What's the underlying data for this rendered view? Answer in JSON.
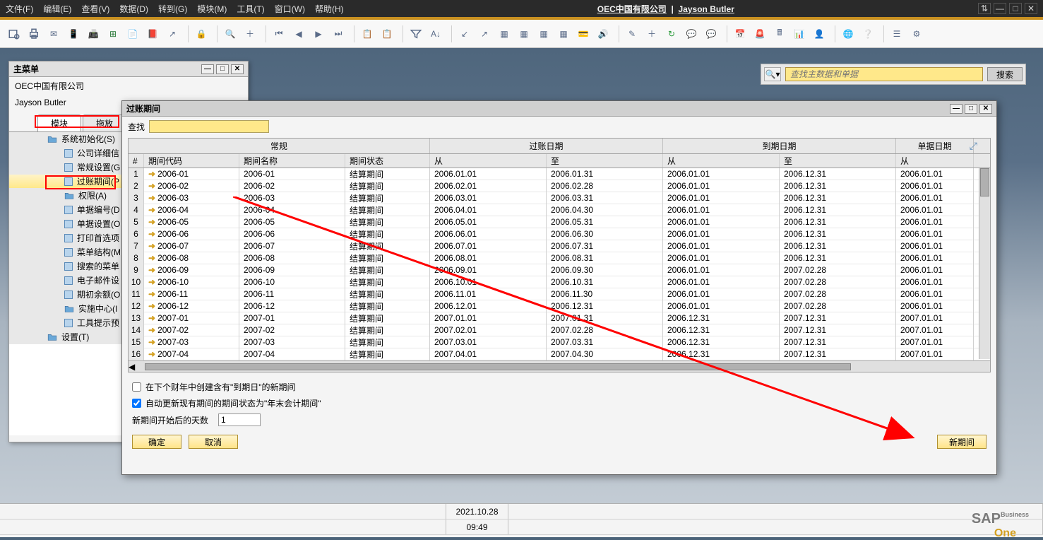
{
  "menubar": {
    "items": [
      "文件(F)",
      "编辑(E)",
      "查看(V)",
      "数据(D)",
      "转到(G)",
      "模块(M)",
      "工具(T)",
      "窗口(W)",
      "帮助(H)"
    ],
    "title_company": "OEC中国有限公司",
    "title_user": "Jayson Butler"
  },
  "topsearch": {
    "placeholder": "查找主数据和单据",
    "button": "搜索"
  },
  "mainmenu": {
    "title": "主菜单",
    "company": "OEC中国有限公司",
    "user": "Jayson Butler",
    "tabs": [
      "模块",
      "拖放"
    ],
    "tree": [
      {
        "lvl": 1,
        "type": "folder",
        "label": "系统初始化(S)"
      },
      {
        "lvl": 2,
        "type": "doc",
        "label": "公司详细信"
      },
      {
        "lvl": 2,
        "type": "doc",
        "label": "常规设置(G"
      },
      {
        "lvl": 2,
        "type": "doc",
        "label": "过账期间(P",
        "selected": true
      },
      {
        "lvl": 2,
        "type": "folder",
        "label": "权限(A)"
      },
      {
        "lvl": 2,
        "type": "doc",
        "label": "单据编号(D"
      },
      {
        "lvl": 2,
        "type": "doc",
        "label": "单据设置(O"
      },
      {
        "lvl": 2,
        "type": "doc",
        "label": "打印首选项"
      },
      {
        "lvl": 2,
        "type": "doc",
        "label": "菜单结构(M"
      },
      {
        "lvl": 2,
        "type": "doc",
        "label": "搜索的菜单"
      },
      {
        "lvl": 2,
        "type": "doc",
        "label": "电子邮件设"
      },
      {
        "lvl": 2,
        "type": "doc",
        "label": "期初余额(O"
      },
      {
        "lvl": 2,
        "type": "folder",
        "label": "实施中心(I"
      },
      {
        "lvl": 2,
        "type": "doc",
        "label": "工具提示预"
      },
      {
        "lvl": 1,
        "type": "folder",
        "label": "设置(T)"
      }
    ]
  },
  "dialog": {
    "title": "过账期间",
    "search_label": "查找",
    "groups": [
      "常规",
      "过账日期",
      "到期日期",
      "单据日期"
    ],
    "columns": {
      "num": "#",
      "code": "期间代码",
      "name": "期间名称",
      "status": "期间状态",
      "pfrom": "从",
      "pto": "至",
      "dfrom": "从",
      "dto": "至",
      "docfrom": "从"
    },
    "rows": [
      {
        "n": 1,
        "code": "2006-01",
        "name": "2006-01",
        "status": "结算期间",
        "pf": "2006.01.01",
        "pt": "2006.01.31",
        "df": "2006.01.01",
        "dt": "2006.12.31",
        "doc": "2006.01.01"
      },
      {
        "n": 2,
        "code": "2006-02",
        "name": "2006-02",
        "status": "结算期间",
        "pf": "2006.02.01",
        "pt": "2006.02.28",
        "df": "2006.01.01",
        "dt": "2006.12.31",
        "doc": "2006.01.01"
      },
      {
        "n": 3,
        "code": "2006-03",
        "name": "2006-03",
        "status": "结算期间",
        "pf": "2006.03.01",
        "pt": "2006.03.31",
        "df": "2006.01.01",
        "dt": "2006.12.31",
        "doc": "2006.01.01"
      },
      {
        "n": 4,
        "code": "2006-04",
        "name": "2006-04",
        "status": "结算期间",
        "pf": "2006.04.01",
        "pt": "2006.04.30",
        "df": "2006.01.01",
        "dt": "2006.12.31",
        "doc": "2006.01.01"
      },
      {
        "n": 5,
        "code": "2006-05",
        "name": "2006-05",
        "status": "结算期间",
        "pf": "2006.05.01",
        "pt": "2006.05.31",
        "df": "2006.01.01",
        "dt": "2006.12.31",
        "doc": "2006.01.01"
      },
      {
        "n": 6,
        "code": "2006-06",
        "name": "2006-06",
        "status": "结算期间",
        "pf": "2006.06.01",
        "pt": "2006.06.30",
        "df": "2006.01.01",
        "dt": "2006.12.31",
        "doc": "2006.01.01"
      },
      {
        "n": 7,
        "code": "2006-07",
        "name": "2006-07",
        "status": "结算期间",
        "pf": "2006.07.01",
        "pt": "2006.07.31",
        "df": "2006.01.01",
        "dt": "2006.12.31",
        "doc": "2006.01.01"
      },
      {
        "n": 8,
        "code": "2006-08",
        "name": "2006-08",
        "status": "结算期间",
        "pf": "2006.08.01",
        "pt": "2006.08.31",
        "df": "2006.01.01",
        "dt": "2006.12.31",
        "doc": "2006.01.01"
      },
      {
        "n": 9,
        "code": "2006-09",
        "name": "2006-09",
        "status": "结算期间",
        "pf": "2006.09.01",
        "pt": "2006.09.30",
        "df": "2006.01.01",
        "dt": "2007.02.28",
        "doc": "2006.01.01"
      },
      {
        "n": 10,
        "code": "2006-10",
        "name": "2006-10",
        "status": "结算期间",
        "pf": "2006.10.01",
        "pt": "2006.10.31",
        "df": "2006.01.01",
        "dt": "2007.02.28",
        "doc": "2006.01.01"
      },
      {
        "n": 11,
        "code": "2006-11",
        "name": "2006-11",
        "status": "结算期间",
        "pf": "2006.11.01",
        "pt": "2006.11.30",
        "df": "2006.01.01",
        "dt": "2007.02.28",
        "doc": "2006.01.01"
      },
      {
        "n": 12,
        "code": "2006-12",
        "name": "2006-12",
        "status": "结算期间",
        "pf": "2006.12.01",
        "pt": "2006.12.31",
        "df": "2006.01.01",
        "dt": "2007.02.28",
        "doc": "2006.01.01"
      },
      {
        "n": 13,
        "code": "2007-01",
        "name": "2007-01",
        "status": "结算期间",
        "pf": "2007.01.01",
        "pt": "2007.01.31",
        "df": "2006.12.31",
        "dt": "2007.12.31",
        "doc": "2007.01.01"
      },
      {
        "n": 14,
        "code": "2007-02",
        "name": "2007-02",
        "status": "结算期间",
        "pf": "2007.02.01",
        "pt": "2007.02.28",
        "df": "2006.12.31",
        "dt": "2007.12.31",
        "doc": "2007.01.01"
      },
      {
        "n": 15,
        "code": "2007-03",
        "name": "2007-03",
        "status": "结算期间",
        "pf": "2007.03.01",
        "pt": "2007.03.31",
        "df": "2006.12.31",
        "dt": "2007.12.31",
        "doc": "2007.01.01"
      },
      {
        "n": 16,
        "code": "2007-04",
        "name": "2007-04",
        "status": "结算期间",
        "pf": "2007.04.01",
        "pt": "2007.04.30",
        "df": "2006.12.31",
        "dt": "2007.12.31",
        "doc": "2007.01.01"
      }
    ],
    "check1": "在下个财年中创建含有\"到期日\"的新期间",
    "check2": "自动更新现有期间的期间状态为\"年末会计期间\"",
    "days_label": "新期间开始后的天数",
    "days_value": "1",
    "ok": "确定",
    "cancel": "取消",
    "newperiod": "新期间"
  },
  "statusbar": {
    "date": "2021.10.28",
    "time": "09:49",
    "logo_sap": "SAP",
    "logo_biz": "Business",
    "logo_one": "One"
  }
}
